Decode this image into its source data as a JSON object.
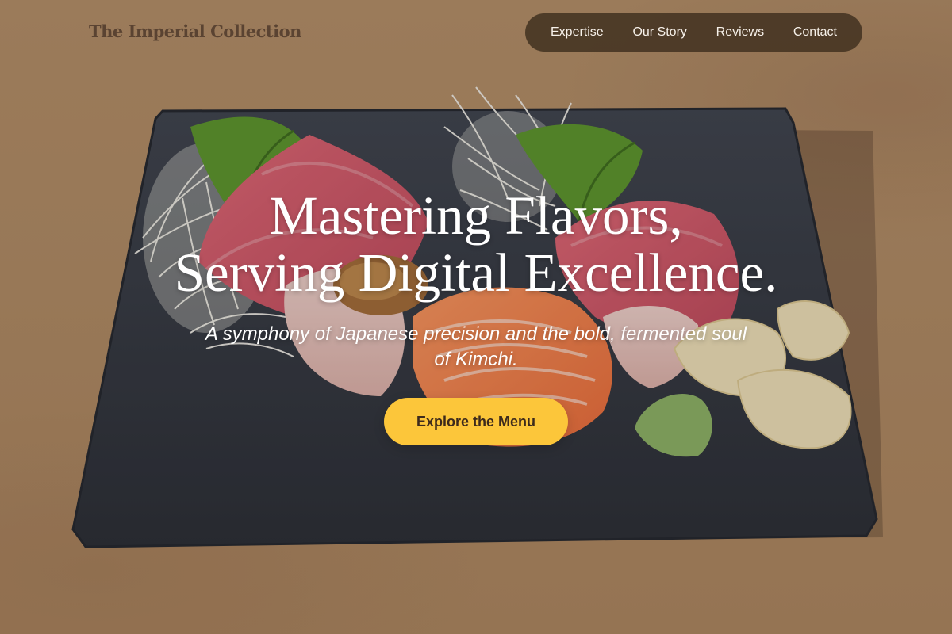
{
  "brand": {
    "name": "The Imperial Collection"
  },
  "nav": {
    "items": [
      {
        "label": "Expertise"
      },
      {
        "label": "Our Story"
      },
      {
        "label": "Reviews"
      },
      {
        "label": "Contact"
      }
    ]
  },
  "hero": {
    "title_line_1": "Mastering Flavors,",
    "title_line_2": "Serving Digital Excellence.",
    "subtitle": "A symphony of Japanese precision and the bold, fermented soul of Kimchi.",
    "cta_label": "Explore the Menu",
    "background_image_alt": "Sashimi platter on a dark slate board"
  },
  "colors": {
    "background": "#b48f68",
    "nav_pill": "#483624",
    "brand_text": "#5a4332",
    "cta": "#fcc63a",
    "cta_text": "#3d2a1c",
    "hero_text": "#ffffff"
  }
}
